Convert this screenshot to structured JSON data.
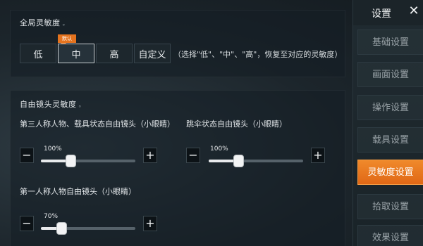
{
  "sidebar": {
    "title": "设置",
    "items": [
      {
        "label": "基础设置",
        "active": false
      },
      {
        "label": "画面设置",
        "active": false
      },
      {
        "label": "操作设置",
        "active": false
      },
      {
        "label": "载具设置",
        "active": false
      },
      {
        "label": "灵敏度设置",
        "active": true
      },
      {
        "label": "拾取设置",
        "active": false
      },
      {
        "label": "效果设置",
        "active": false
      }
    ],
    "close_icon": "close-icon"
  },
  "global_sensitivity": {
    "title": "全局灵敏度",
    "title_mark": "。",
    "options": [
      "低",
      "中",
      "高",
      "自定义"
    ],
    "selected": "中",
    "selected_badge": "默认",
    "hint": "（选择\"低\"、\"中\"、\"高\"，恢复至对应的灵敏度）"
  },
  "free_camera": {
    "title": "自由镜头灵敏度",
    "title_mark": "。",
    "sliders": [
      {
        "label": "第三人称人物、载具状态自由镜头（小眼睛）",
        "value_text": "100%",
        "fill_fraction": 0.31
      },
      {
        "label": "跳伞状态自由镜头（小眼睛）",
        "value_text": "100%",
        "fill_fraction": 0.31
      },
      {
        "label": "第一人称人物自由镜头（小眼睛）",
        "value_text": "70%",
        "fill_fraction": 0.22
      }
    ],
    "minus_symbol": "−",
    "plus_symbol": "+"
  },
  "colors": {
    "accent": "#e5731e",
    "background": "#1c252b"
  }
}
